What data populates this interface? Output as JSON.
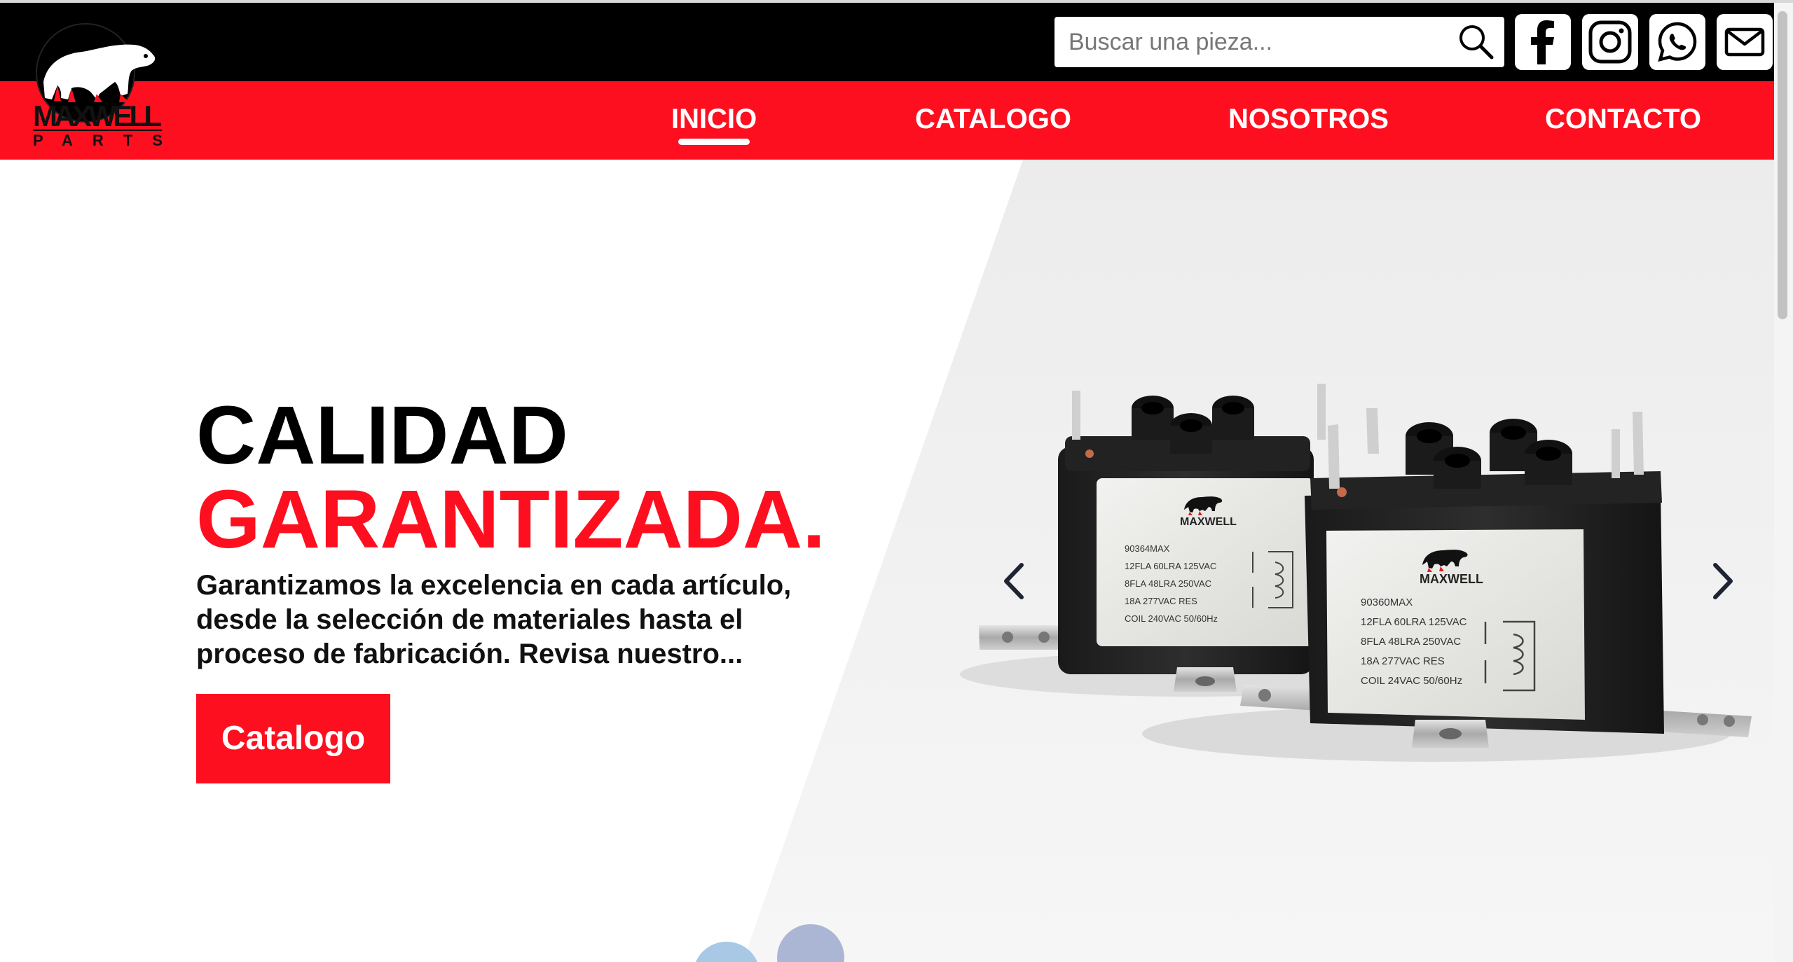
{
  "brand": {
    "name": "MAXWELL",
    "sub": "PARTS"
  },
  "search": {
    "placeholder": "Buscar una pieza..."
  },
  "social": [
    {
      "label": "Facebook",
      "icon": "facebook-icon"
    },
    {
      "label": "Instagram",
      "icon": "instagram-icon"
    },
    {
      "label": "WhatsApp",
      "icon": "whatsapp-icon"
    },
    {
      "label": "Email",
      "icon": "mail-icon"
    }
  ],
  "nav": {
    "items": [
      {
        "label": "INICIO",
        "active": true
      },
      {
        "label": "CATALOGO"
      },
      {
        "label": "NOSOTROS"
      },
      {
        "label": "CONTACTO"
      }
    ]
  },
  "hero": {
    "title_line1": "CALIDAD",
    "title_line2": "GARANTIZADA.",
    "description": "Garantizamos la excelencia en cada artículo, desde la selección de materiales hasta el proceso de fabricación. Revisa nuestro...",
    "cta_label": "Catalogo",
    "relay_left": {
      "brand": "MAXWELL",
      "lines": [
        "90364MAX",
        "12FLA 60LRA 125VAC",
        "8FLA 48LRA 250VAC",
        "18A 277VAC RES",
        "COIL 240VAC 50/60Hz"
      ]
    },
    "relay_right": {
      "brand": "MAXWELL",
      "lines": [
        "90360MAX",
        "12FLA 60LRA 125VAC",
        "8FLA 48LRA 250VAC",
        "18A 277VAC RES",
        "COIL 24VAC 50/60Hz"
      ]
    }
  },
  "colors": {
    "brand_red": "#fe0f1f",
    "topbar": "#000000",
    "white": "#ffffff"
  }
}
